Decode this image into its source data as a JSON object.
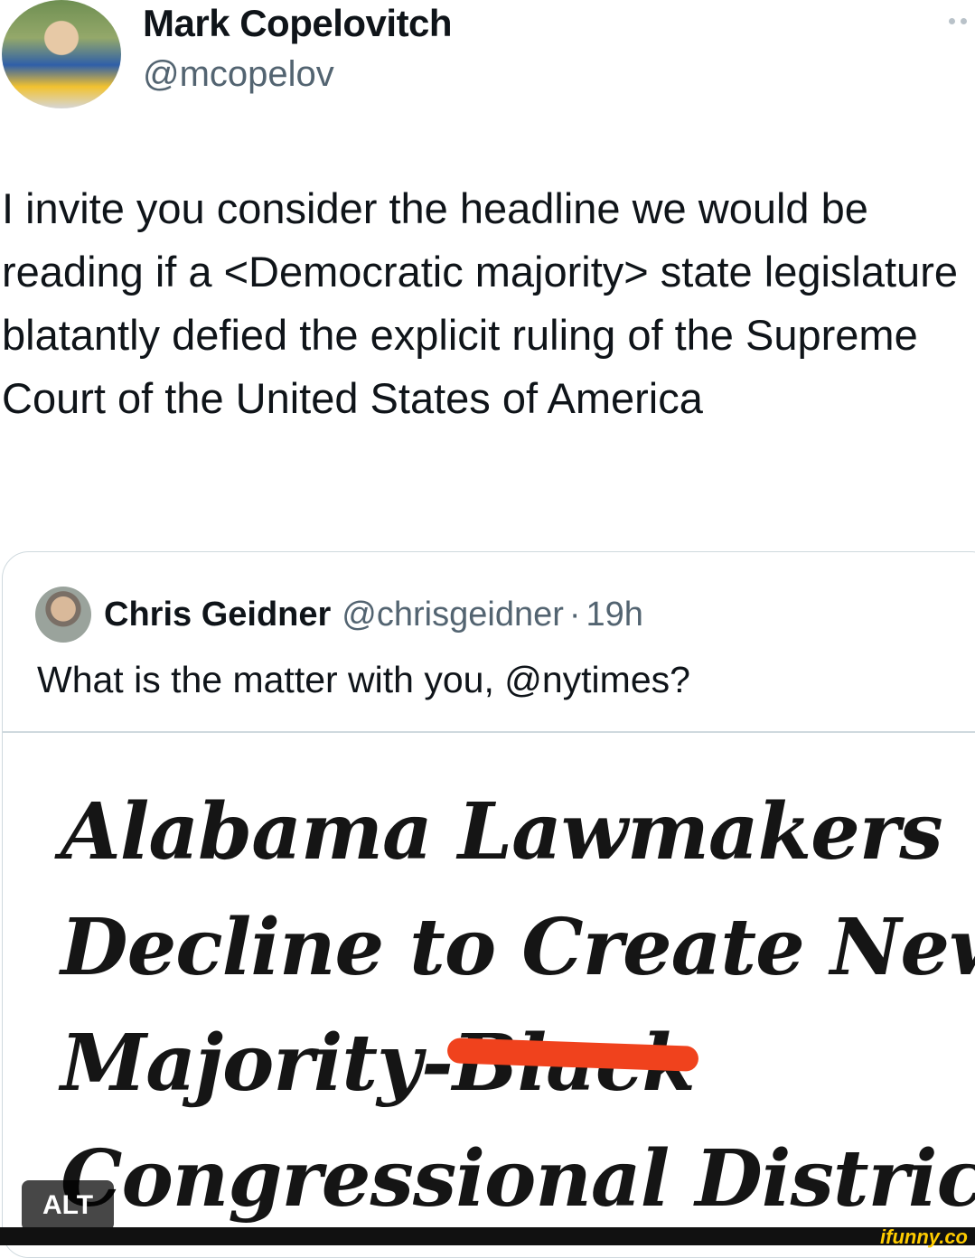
{
  "author": {
    "name": "Mark Copelovitch",
    "handle": "@mcopelov"
  },
  "tweet_text": "I invite you consider the headline we would be reading if a <Democratic majority> state legislature blatantly defied the explicit ruling of the Supreme Court of the United States of America",
  "quoted_tweet": {
    "name": "Chris Geidner",
    "handle": "@chrisgeidner",
    "separator": "·",
    "time": "19h",
    "text": "What is the matter with you, @nytimes?",
    "image": {
      "headline_line1": "Alabama Lawmakers",
      "headline_line2": "Decline to Create New",
      "headline_line3a": "Majority-",
      "headline_line3b": "Black",
      "headline_line4": "Congressional District",
      "alt_label": "ALT"
    }
  },
  "watermark": "ifunny.co",
  "colors": {
    "text": "#0f1419",
    "secondary": "#536471",
    "border": "#cfd9de",
    "redaction": "#f0421d"
  }
}
